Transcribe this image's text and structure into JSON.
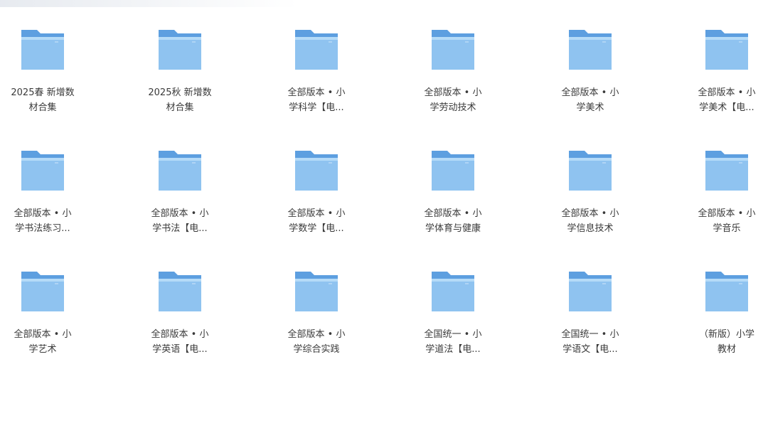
{
  "folders": [
    {
      "line1": "2025春 新增数",
      "line2": "材合集"
    },
    {
      "line1": "2025秋 新增数",
      "line2": "材合集"
    },
    {
      "line1": "全部版本 • 小",
      "line2": "学科学【电..."
    },
    {
      "line1": "全部版本 • 小",
      "line2": "学劳动技术"
    },
    {
      "line1": "全部版本 • 小",
      "line2": "学美术"
    },
    {
      "line1": "全部版本 • 小",
      "line2": "学美术【电..."
    },
    {
      "line1": "全部版本 • 小",
      "line2": "学书法练习..."
    },
    {
      "line1": "全部版本 • 小",
      "line2": "学书法【电..."
    },
    {
      "line1": "全部版本 • 小",
      "line2": "学数学【电..."
    },
    {
      "line1": "全部版本 • 小",
      "line2": "学体育与健康"
    },
    {
      "line1": "全部版本 • 小",
      "line2": "学信息技术"
    },
    {
      "line1": "全部版本 • 小",
      "line2": "学音乐"
    },
    {
      "line1": "全部版本 • 小",
      "line2": "学艺术"
    },
    {
      "line1": "全部版本 • 小",
      "line2": "学英语【电..."
    },
    {
      "line1": "全部版本 • 小",
      "line2": "学综合实践"
    },
    {
      "line1": "全国统一 • 小",
      "line2": "学道法【电..."
    },
    {
      "line1": "全国统一 • 小",
      "line2": "学语文【电..."
    },
    {
      "line1": "（新版）小学",
      "line2": "教材"
    }
  ],
  "icon": "folder-icon",
  "colors": {
    "folder_back": "#5d9fe0",
    "folder_front_top": "#a9d3f6",
    "folder_front_bottom": "#7fb9ec",
    "label_text": "#3a3a3a"
  }
}
